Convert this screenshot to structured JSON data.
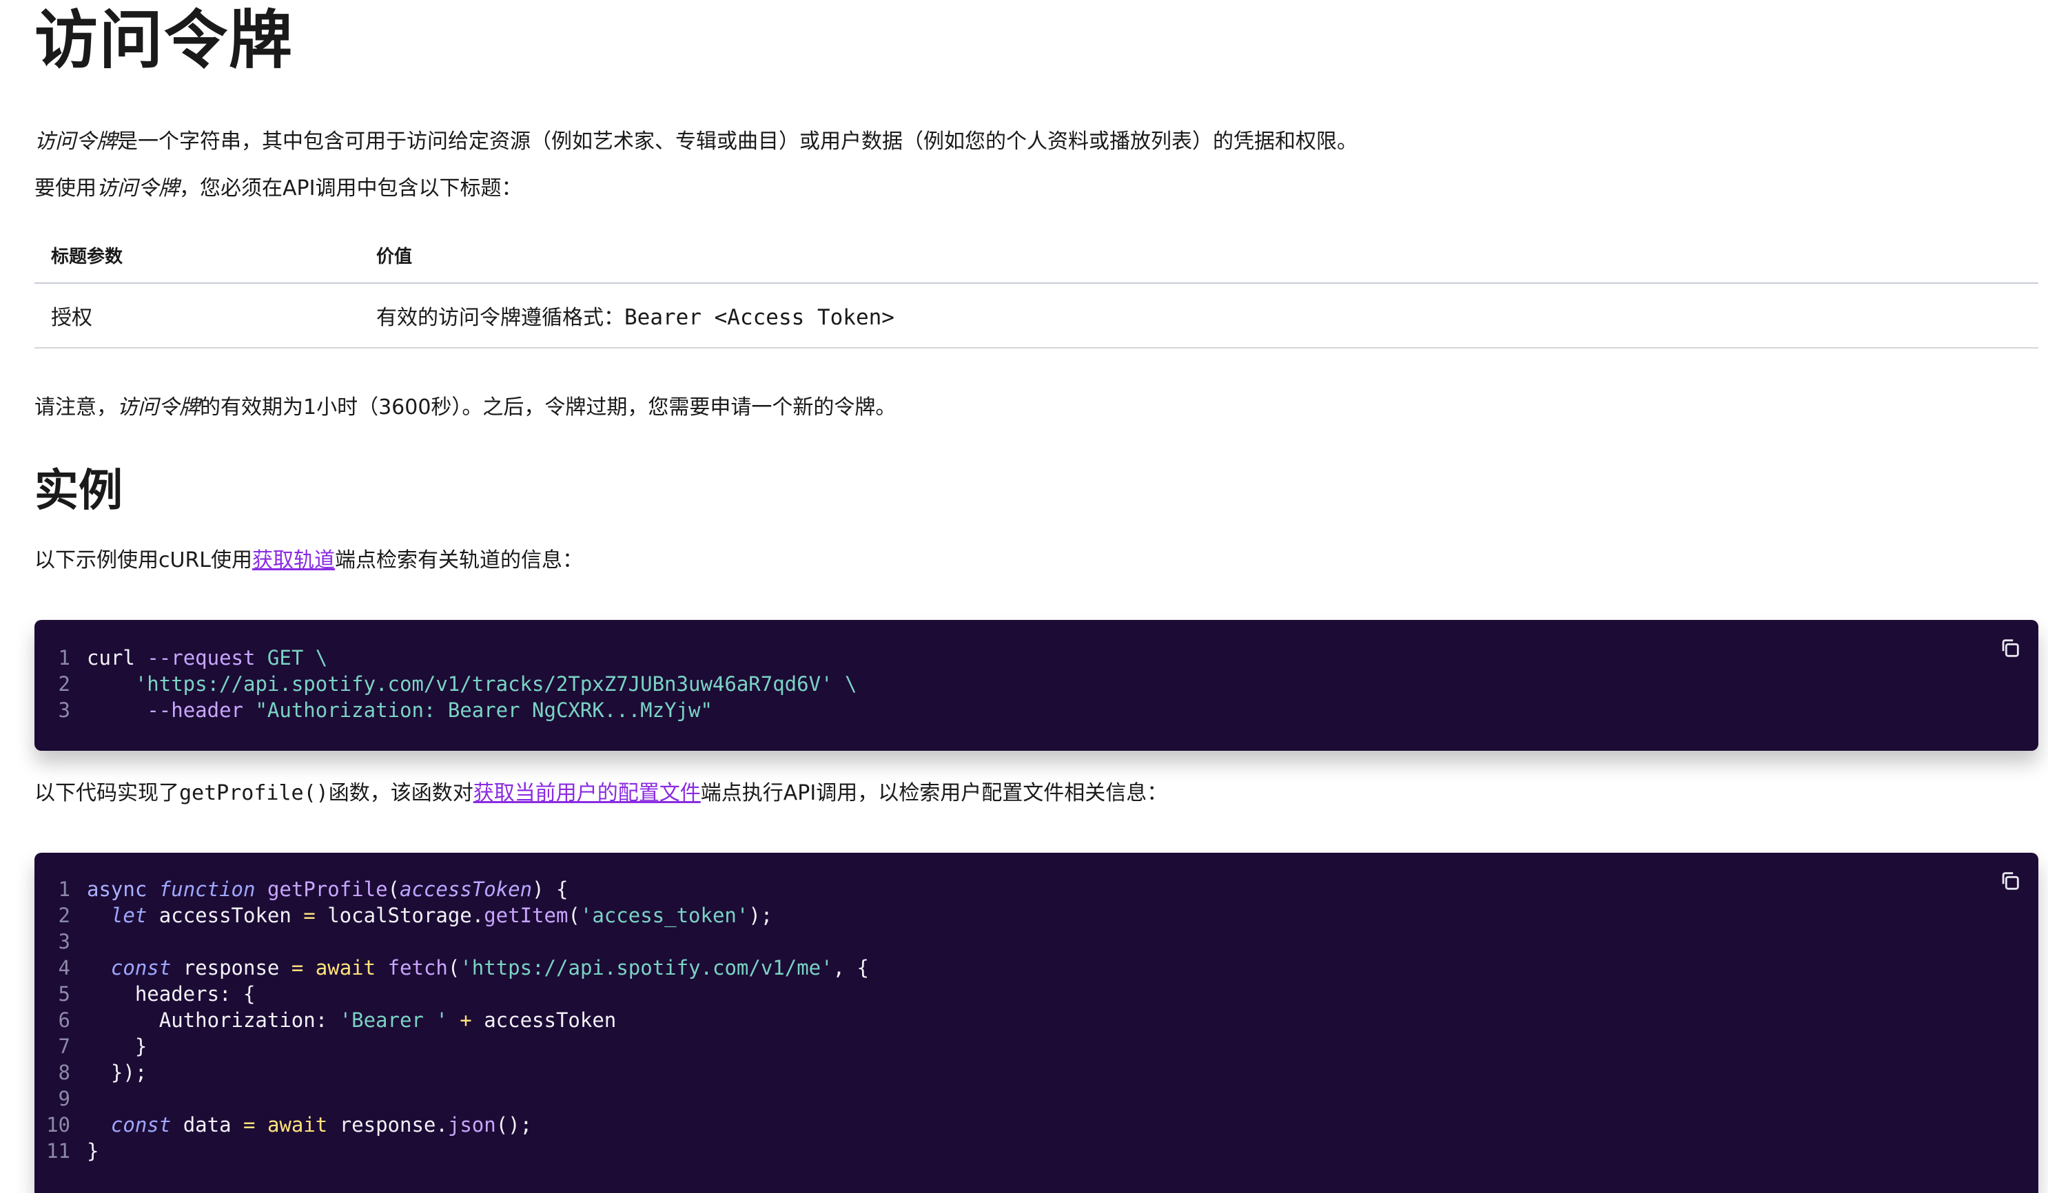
{
  "title": "访问令牌",
  "intro": {
    "em": "访问令牌",
    "text": "是一个字符串，其中包含可用于访问给定资源（例如艺术家、专辑或曲目）或用户数据（例如您的个人资料或播放列表）的凭据和权限。"
  },
  "usage": {
    "prefix": "要使用",
    "em": "访问令牌",
    "suffix": "，您必须在API调用中包含以下标题："
  },
  "table": {
    "headers": [
      "标题参数",
      "价值"
    ],
    "rows": [
      {
        "param": "授权",
        "value_prefix": "有效的访问令牌遵循格式：",
        "value_code": "Bearer <Access Token>"
      }
    ]
  },
  "note": {
    "prefix": "请注意，",
    "em": "访问令牌",
    "suffix": "的有效期为1小时（3600秒）。之后，令牌过期，您需要申请一个新的令牌。"
  },
  "example_heading": "实例",
  "example1": {
    "prefix": "以下示例使用cURL使用",
    "link": "获取轨道",
    "suffix": "端点检索有关轨道的信息："
  },
  "code1": {
    "lines": [
      "1",
      "2",
      "3"
    ],
    "curl": "curl",
    "request_flag": "--request",
    "method": "GET",
    "backslash": "\\",
    "url": "'https://api.spotify.com/v1/tracks/2TpxZ7JUBn3uw46aR7qd6V'",
    "header_flag": "--header",
    "header_value": "\"Authorization: Bearer NgCXRK...MzYjw\""
  },
  "example2": {
    "prefix": "以下代码实现了",
    "code": "getProfile()",
    "middle": "函数，该函数对",
    "link": "获取当前用户的配置文件",
    "suffix": "端点执行API调用，以检索用户配置文件相关信息："
  },
  "code2": {
    "lines": [
      "1",
      "2",
      "3",
      "4",
      "5",
      "6",
      "7",
      "8",
      "9",
      "10",
      "11"
    ]
  }
}
